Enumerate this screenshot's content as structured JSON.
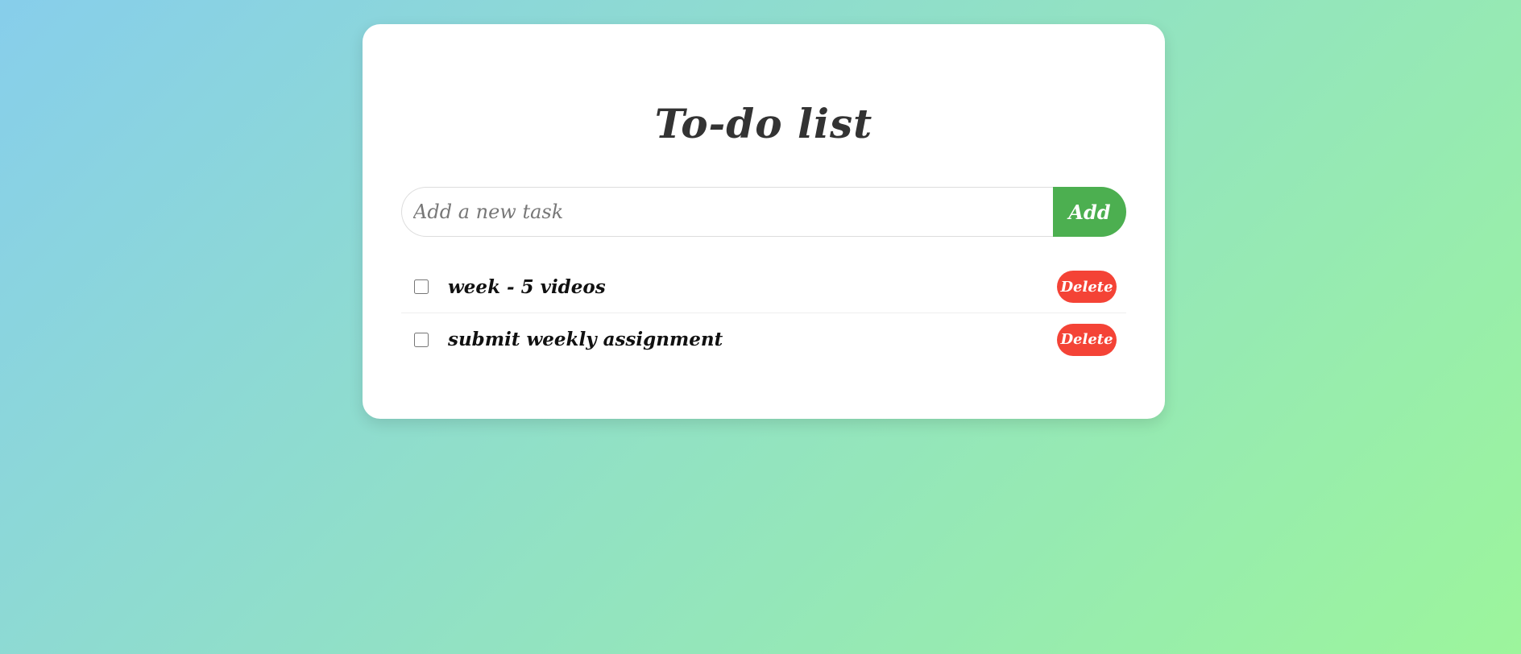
{
  "app": {
    "title": "To-do list"
  },
  "input": {
    "placeholder": "Add a new task",
    "value": ""
  },
  "add_button": {
    "label": "Add"
  },
  "tasks": [
    {
      "text": "week - 5 videos",
      "done": false,
      "delete_label": "Delete"
    },
    {
      "text": "submit weekly assignment",
      "done": false,
      "delete_label": "Delete"
    }
  ],
  "colors": {
    "add_button": "#4caf50",
    "delete_button": "#f44336",
    "title_text": "#333333",
    "background_start": "#87ceeb",
    "background_end": "#9cf59c"
  }
}
